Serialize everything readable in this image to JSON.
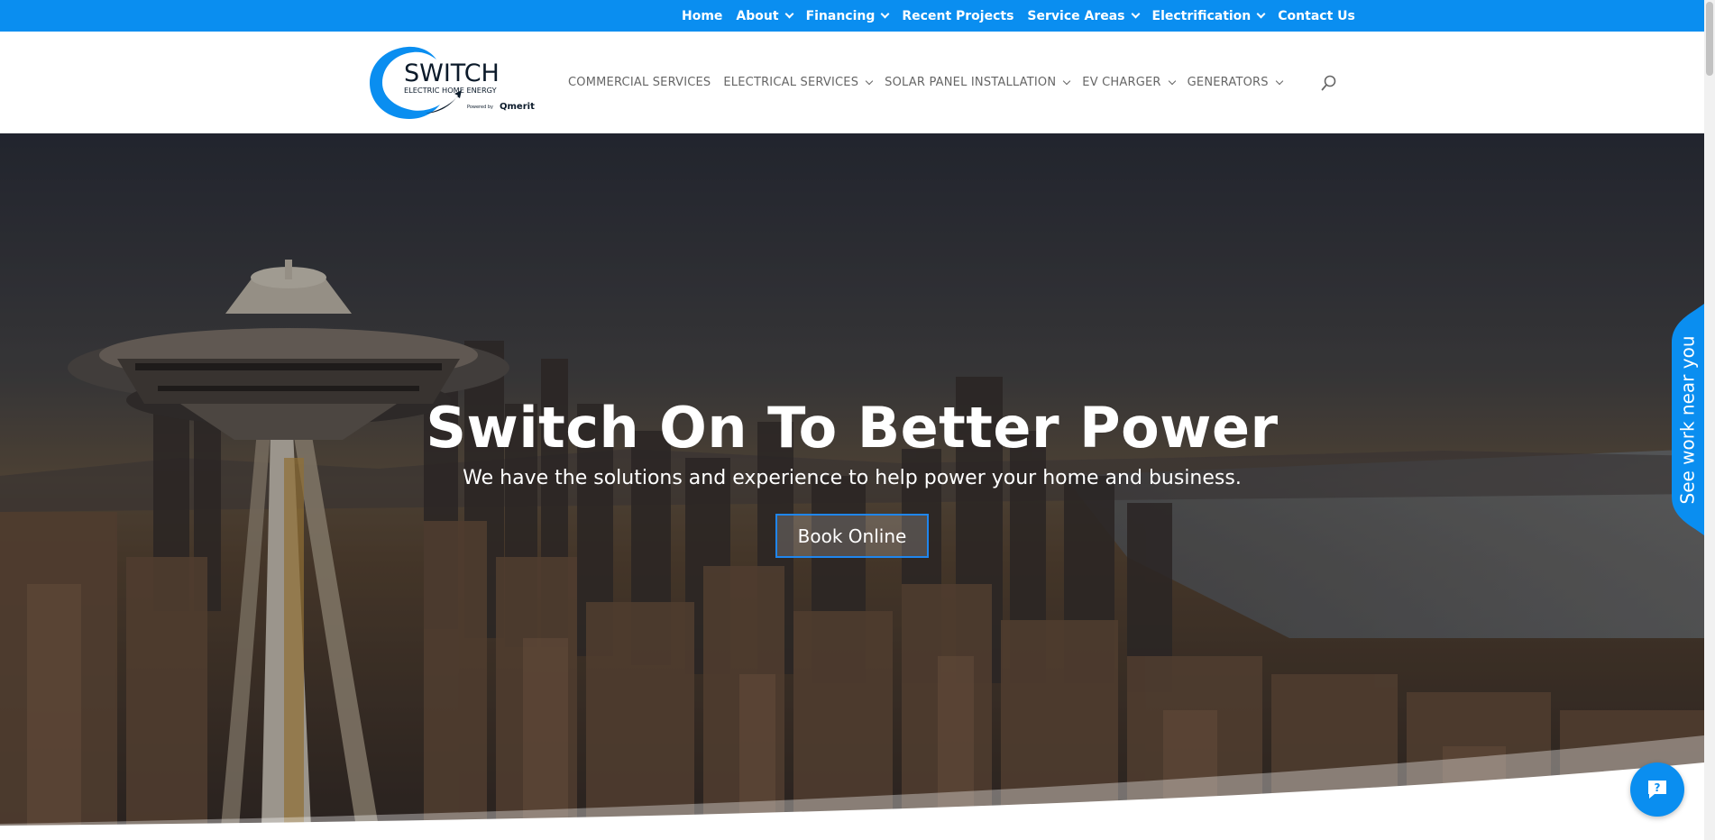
{
  "topnav": {
    "items": [
      {
        "label": "Home",
        "has_dropdown": false
      },
      {
        "label": "About",
        "has_dropdown": true
      },
      {
        "label": "Financing",
        "has_dropdown": true
      },
      {
        "label": "Recent Projects",
        "has_dropdown": false
      },
      {
        "label": "Service Areas",
        "has_dropdown": true
      },
      {
        "label": "Electrification",
        "has_dropdown": true
      },
      {
        "label": "Contact Us",
        "has_dropdown": false
      }
    ]
  },
  "logo": {
    "name": "SWITCH",
    "tagline": "ELECTRIC HOME ENERGY",
    "powered_by": "Powered by",
    "partner": "Qmerit"
  },
  "mainnav": {
    "items": [
      {
        "label": "COMMERCIAL SERVICES",
        "has_dropdown": false
      },
      {
        "label": "ELECTRICAL SERVICES",
        "has_dropdown": true
      },
      {
        "label": "SOLAR PANEL INSTALLATION",
        "has_dropdown": true
      },
      {
        "label": "EV CHARGER",
        "has_dropdown": true
      },
      {
        "label": "GENERATORS",
        "has_dropdown": true
      }
    ],
    "search_icon": "search-icon"
  },
  "hero": {
    "title": "Switch On To Better Power",
    "subtitle": "We have the solutions and experience to help power your home and business.",
    "cta_label": "Book Online"
  },
  "sidetab": {
    "label": "See work near you"
  },
  "help": {
    "icon": "question-chat-icon"
  },
  "colors": {
    "brand_blue": "#0a8ef0",
    "button_border": "#1f86ee",
    "nav_text": "#666666"
  }
}
